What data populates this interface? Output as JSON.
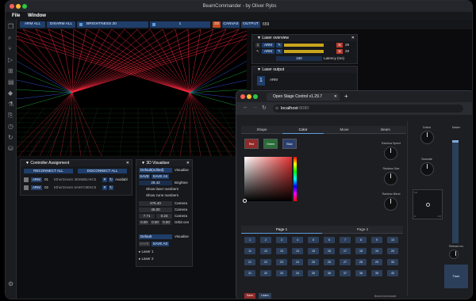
{
  "window": {
    "title": "BeamCommander - by Oliver Rybs"
  },
  "menu": [
    "File",
    "Window"
  ],
  "toolbar": {
    "arm_all": "ARM ALL",
    "disarm_all": "DISARM ALL",
    "brightness": "BRIGHTNESS 20",
    "value": "1",
    "three_d": "3D",
    "canvas": "CANVAS",
    "output": "OUTPUT",
    "fps": "659"
  },
  "laser_overview": {
    "title": "Laser overview",
    "rows": [
      {
        "index": "1",
        "arm": "ARM",
        "count": "29"
      },
      {
        "index": "2",
        "arm": "ARM",
        "count": "29"
      }
    ],
    "latency_value": "150",
    "latency_label": "Latency (ms)"
  },
  "laser_output": {
    "title": "Laser output",
    "index": "1",
    "arm": "ARM"
  },
  "controller_assignment": {
    "title": "Controller Assignment",
    "reconnect_all": "RECONNECT ALL",
    "disconnect_all": "DISCONNECT ALL",
    "rows": [
      {
        "arm": "ARM",
        "num": "01",
        "device": "EtherDream 3E95BEA9C5",
        "extra": "Availabl"
      },
      {
        "arm": "ARM",
        "num": "02",
        "device": "EtherDream 6A6FC8E5C9",
        "extra": ""
      }
    ]
  },
  "visualiser": {
    "title": "3D Visualiser",
    "preset": "Default(edited)",
    "visualise": "Visualise",
    "save": "SAVE",
    "save_as": "SAVE AS",
    "brightness_val": "28.42",
    "brightness_lbl": "Brightne",
    "show_laser_numbers": "Show laser numbers",
    "show_zone_numbers": "Show zone numbers",
    "camera1_val": "475.40",
    "camera1_lbl": "Camera",
    "camera2_val": "45.00",
    "camera2_lbl": "Camera",
    "cam3_a": "7.71",
    "cam3_b": "0.24",
    "cam3_lbl": "Camera",
    "orbit_a": "0.00",
    "orbit_b": "0.00",
    "orbit_c": "0.00",
    "orbit_lbl": "Orbit cen",
    "preset2": "Default",
    "visualise2": "Visualise",
    "save2": "SAVE",
    "save_as2": "SAVE AS",
    "laser1": "Laser 1",
    "laser2": "Laser 2"
  },
  "browser": {
    "tab_title": "Open Stage Control v1.29.7",
    "url_host": "localhost",
    "url_port": ":8080"
  },
  "osc": {
    "tabs": [
      "Shape",
      "Color",
      "Move",
      "Beam"
    ],
    "swatches": [
      {
        "label": "Red",
        "color": "#8e2a2a"
      },
      {
        "label": "Green",
        "color": "#2a6b3a"
      },
      {
        "label": "Blue",
        "color": "#2b3f6f"
      }
    ],
    "rainbow_speed": "Rainbow Speed",
    "rainbow_size": "Rainbow Size",
    "rainbow_blend": "Rainbow Blend",
    "xy_min": "0",
    "xy_max": "0.5",
    "xy_top": "0.5",
    "dotted": "Dotted",
    "scanrate": "Scanrate",
    "master": "Master",
    "release_ms": "Release ms",
    "flash": "Flash",
    "page_tabs": [
      "Page 1",
      "Page 2"
    ],
    "grid": [
      "1",
      "2",
      "3",
      "4",
      "5",
      "6",
      "7",
      "8",
      "9",
      "10",
      "11",
      "12",
      "13",
      "14",
      "15",
      "16",
      "17",
      "18",
      "19",
      "20",
      "21",
      "22",
      "23",
      "24",
      "25",
      "26",
      "27",
      "28",
      "29",
      "30",
      "31",
      "32",
      "33",
      "34",
      "35",
      "36",
      "37",
      "38",
      "39",
      "40"
    ],
    "save": "Save",
    "learn": "Learn",
    "brand": "BeamCommander"
  },
  "colors": {
    "accent": "#1f3e6b",
    "danger": "#c0392b",
    "laser_red": "#ff2a40",
    "laser_green": "#20c040",
    "laser_blue": "#4060ff"
  }
}
